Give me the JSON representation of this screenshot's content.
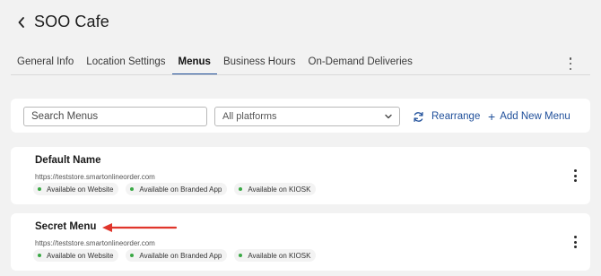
{
  "header": {
    "title": "SOO Cafe"
  },
  "tabs": [
    {
      "label": "General Info",
      "active": false
    },
    {
      "label": "Location Settings",
      "active": false
    },
    {
      "label": "Menus",
      "active": true
    },
    {
      "label": "Business Hours",
      "active": false
    },
    {
      "label": "On-Demand Deliveries",
      "active": false
    }
  ],
  "toolbar": {
    "search_placeholder": "Search Menus",
    "platform_select_value": "All platforms",
    "rearrange_label": "Rearrange",
    "add_new_menu_label": "Add New Menu"
  },
  "menus": [
    {
      "name": "Default Name",
      "url": "https://teststore.smartonlineorder.com",
      "badges": [
        "Available on Website",
        "Available on Branded App",
        "Available on KIOSK"
      ]
    },
    {
      "name": "Secret Menu",
      "url": "https://teststore.smartonlineorder.com",
      "badges": [
        "Available on Website",
        "Available on Branded App",
        "Available on KIOSK"
      ]
    }
  ],
  "colors": {
    "accent": "#1f4f9a",
    "status_green": "#3aa845",
    "annotation_arrow": "#e0352b",
    "background": "#f2f2f2"
  },
  "icons": {
    "back": "chevron-left-icon",
    "more_top": "more-vertical-icon",
    "select_caret": "chevron-down-icon",
    "rearrange": "refresh-icon",
    "add": "plus-icon",
    "menu_more": "more-vertical-icon",
    "annotation": "red-arrow-icon"
  }
}
